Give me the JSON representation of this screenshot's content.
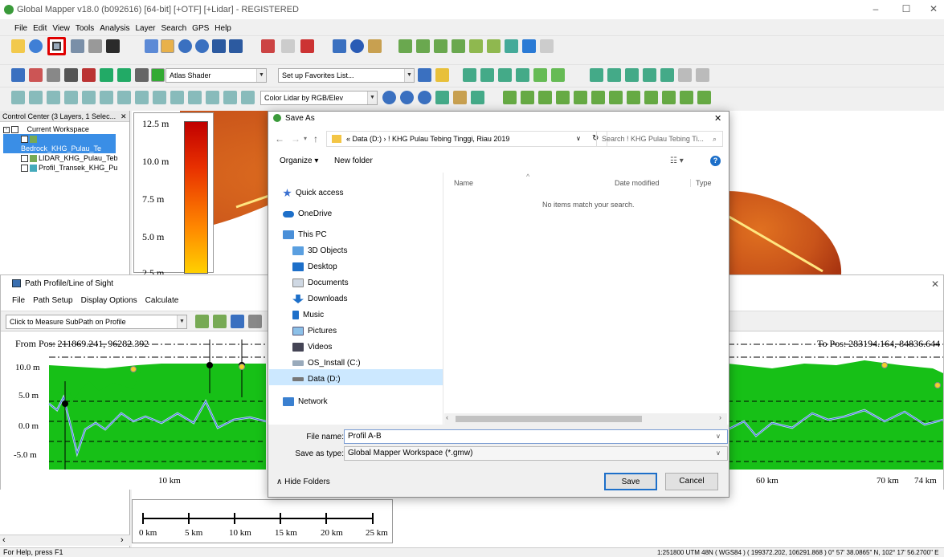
{
  "window": {
    "title": "Global Mapper v18.0 (b092616) [64-bit] [+OTF] [+Lidar] - REGISTERED",
    "minimize": "–",
    "maximize": "☐",
    "close": "✕"
  },
  "menu": [
    "File",
    "Edit",
    "View",
    "Tools",
    "Analysis",
    "Layer",
    "Search",
    "GPS",
    "Help"
  ],
  "toolbar": {
    "shader_select": "Atlas Shader",
    "favorites_select": "Set up Favorites List...",
    "lidar_color_select": "Color Lidar by RGB/Elev",
    "highlight_color": "#e00000"
  },
  "control_center": {
    "title": "Control Center (3 Layers, 1 Selec...",
    "close": "✕",
    "root": "Current Workspace",
    "layers": [
      "Bedrock_KHG_Pulau_Te",
      "LIDAR_KHG_Pulau_Teb",
      "Profil_Transek_KHG_Pu"
    ]
  },
  "legend": {
    "ticks": [
      "12.5 m",
      "10.0 m",
      "7.5 m",
      "5.0 m",
      "2.5 m"
    ]
  },
  "scale_bar": {
    "labels": [
      "0 km",
      "5 km",
      "10 km",
      "15 km",
      "20 km",
      "25 km"
    ]
  },
  "status": {
    "left": "For Help, press F1",
    "right": "1:251800  UTM 48N ( WGS84 ) ( 199372.202, 106291.868 )  0° 57' 38.0865\" N, 102° 17' 56.2700\" E"
  },
  "profile_window": {
    "title": "Path Profile/Line of Sight",
    "close": "✕",
    "menu": [
      "File",
      "Path Setup",
      "Display Options",
      "Calculate"
    ],
    "mode_select": "Click to Measure SubPath on Profile",
    "from_pos": "From Pos: 211869.241, 96282.392",
    "to_pos": "To Pos: 283194.164, 84836.644",
    "y_labels": [
      "10.0 m",
      "5.0 m",
      "0.0 m",
      "-5.0 m"
    ],
    "x_labels": [
      "10 km",
      "60 km",
      "70 km",
      "74 km"
    ]
  },
  "save_dialog": {
    "title": "Save As",
    "close": "✕",
    "breadcrumb": "« Data (D:) › ! KHG Pulau Tebing Tinggi, Riau 2019",
    "search_placeholder": "Search ! KHG Pulau Tebing Ti...",
    "organize": "Organize ▾",
    "new_folder": "New folder",
    "columns": {
      "name": "Name",
      "date": "Date modified",
      "type": "Type"
    },
    "empty_message": "No items match your search.",
    "nav": [
      {
        "label": "Quick access",
        "icon": "star-icon"
      },
      {
        "label": "OneDrive",
        "icon": "cloud-icon"
      },
      {
        "label": "This PC",
        "icon": "computer-icon"
      },
      {
        "label": "3D Objects",
        "icon": "cube-icon"
      },
      {
        "label": "Desktop",
        "icon": "desktop-icon"
      },
      {
        "label": "Documents",
        "icon": "documents-icon"
      },
      {
        "label": "Downloads",
        "icon": "download-icon"
      },
      {
        "label": "Music",
        "icon": "music-icon"
      },
      {
        "label": "Pictures",
        "icon": "pictures-icon"
      },
      {
        "label": "Videos",
        "icon": "videos-icon"
      },
      {
        "label": "OS_Install (C:)",
        "icon": "drive-icon"
      },
      {
        "label": "Data (D:)",
        "icon": "drive-icon"
      },
      {
        "label": "Network",
        "icon": "network-icon"
      }
    ],
    "file_name_label": "File name:",
    "file_name": "Profil A-B",
    "save_type_label": "Save as type:",
    "save_type": "Global Mapper Workspace (*.gmw)",
    "hide_folders": "Hide Folders",
    "save": "Save",
    "cancel": "Cancel"
  }
}
